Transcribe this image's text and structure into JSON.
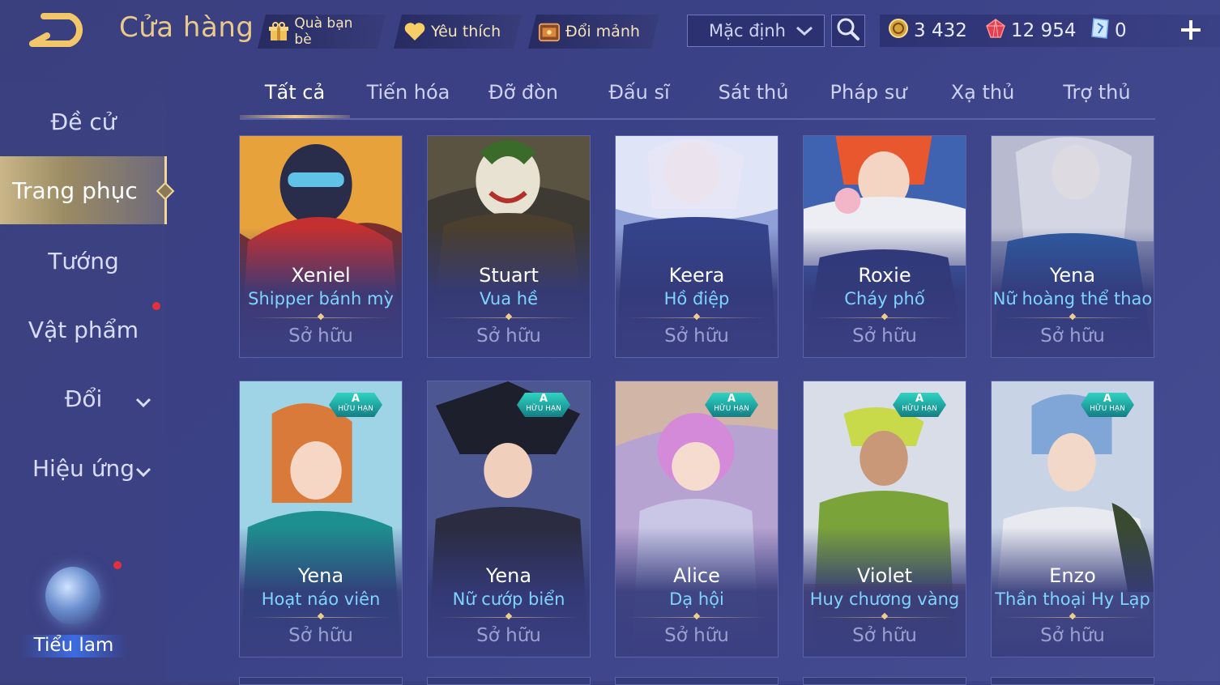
{
  "header": {
    "title": "Cửa hàng",
    "buttons": {
      "gift": "Quà bạn bè",
      "favorite": "Yêu thích",
      "exchange": "Đổi mảnh"
    },
    "sort": {
      "selected": "Mặc định"
    },
    "currencies": {
      "gold": "3 432",
      "ruby": "12 954",
      "voucher": "0"
    }
  },
  "sidebar": {
    "items": [
      {
        "label": "Đề cử"
      },
      {
        "label": "Trang phục"
      },
      {
        "label": "Tướng"
      },
      {
        "label": "Vật phẩm"
      },
      {
        "label": "Đổi"
      },
      {
        "label": "Hiệu ứng"
      }
    ],
    "tieulam": "Tiểu lam"
  },
  "tabs": [
    "Tất cả",
    "Tiến hóa",
    "Đỡ đòn",
    "Đấu sĩ",
    "Sát thủ",
    "Pháp sư",
    "Xạ thủ",
    "Trợ thủ"
  ],
  "badge": {
    "grade": "A",
    "tag": "HỮU HẠN"
  },
  "cards": [
    {
      "hero": "Xeniel",
      "skin": "Shipper bánh mỳ",
      "status": "Sở hữu"
    },
    {
      "hero": "Stuart",
      "skin": "Vua hề",
      "status": "Sở hữu"
    },
    {
      "hero": "Keera",
      "skin": "Hồ điệp",
      "status": "Sở hữu"
    },
    {
      "hero": "Roxie",
      "skin": "Cháy phố",
      "status": "Sở hữu"
    },
    {
      "hero": "Yena",
      "skin": "Nữ hoàng thể thao",
      "status": "Sở hữu"
    },
    {
      "hero": "Yena",
      "skin": "Hoạt náo viên",
      "status": "Sở hữu"
    },
    {
      "hero": "Yena",
      "skin": "Nữ cướp biển",
      "status": "Sở hữu"
    },
    {
      "hero": "Alice",
      "skin": "Dạ hội",
      "status": "Sở hữu"
    },
    {
      "hero": "Violet",
      "skin": "Huy chương vàng",
      "status": "Sở hữu"
    },
    {
      "hero": "Enzo",
      "skin": "Thần thoại Hy Lạp",
      "status": "Sở hữu"
    }
  ],
  "colors": {
    "accent_gold": "#e9c98c",
    "skin_name": "#7fd3ff",
    "notification": "#e0313c",
    "badge_teal": "#2fd3c2"
  }
}
